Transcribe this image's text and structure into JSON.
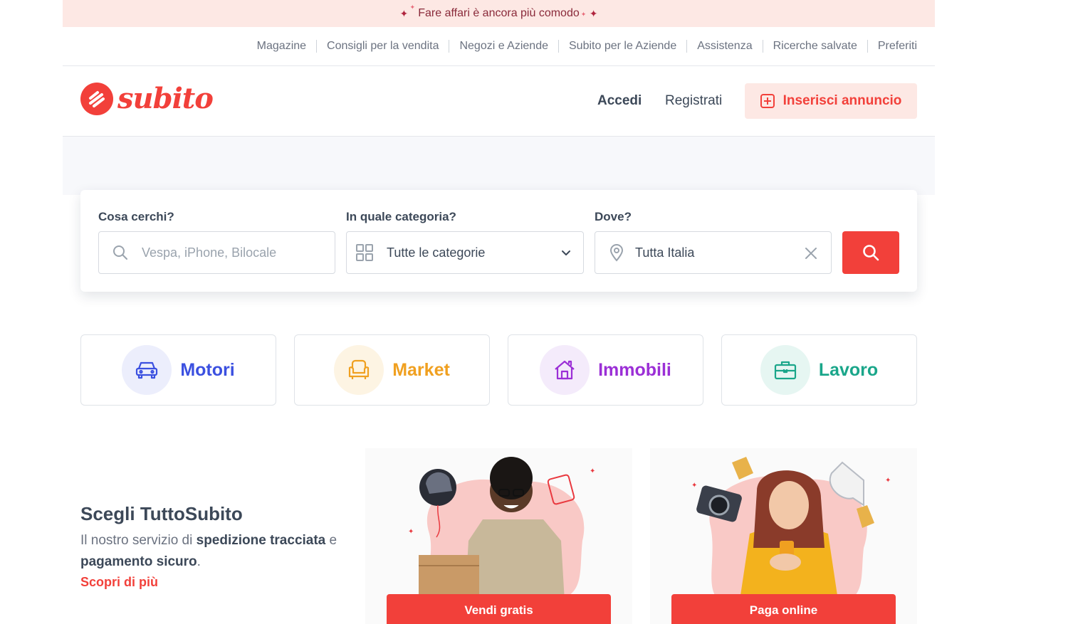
{
  "promo_bar": {
    "text": "Fare affari è ancora più comodo"
  },
  "top_links": [
    "Magazine",
    "Consigli per la vendita",
    "Negozi e Aziende",
    "Subito per le Aziende",
    "Assistenza",
    "Ricerche salvate",
    "Preferiti"
  ],
  "header": {
    "logo_text": "subito",
    "login": "Accedi",
    "register": "Registrati",
    "insert_ad": "Inserisci annuncio"
  },
  "search": {
    "what_label": "Cosa cerchi?",
    "what_placeholder": "Vespa, iPhone, Bilocale",
    "category_label": "In quale categoria?",
    "category_value": "Tutte le categorie",
    "where_label": "Dove?",
    "where_value": "Tutta Italia"
  },
  "categories": [
    {
      "label": "Motori",
      "color": "#3b50e0",
      "bg": "#eceefc",
      "icon": "car-icon"
    },
    {
      "label": "Market",
      "color": "#f0a020",
      "bg": "#fdf4e3",
      "icon": "armchair-icon"
    },
    {
      "label": "Immobili",
      "color": "#9b2fd6",
      "bg": "#f4ebfb",
      "icon": "house-icon"
    },
    {
      "label": "Lavoro",
      "color": "#1aa68a",
      "bg": "#e6f6f2",
      "icon": "briefcase-icon"
    }
  ],
  "tuttosubito": {
    "title": "Scegli TuttoSubito",
    "desc_1": "Il nostro servizio di ",
    "desc_bold_1": "spedizione tracciata",
    "desc_2": " e ",
    "desc_bold_2": "pagamento sicuro",
    "desc_3": ".",
    "link": "Scopri di più"
  },
  "tiles": [
    {
      "button": "Vendi gratis"
    },
    {
      "button": "Paga online"
    }
  ],
  "colors": {
    "brand": "#f2403a",
    "promo_bg": "#fde8e4",
    "text": "#3c4858"
  }
}
